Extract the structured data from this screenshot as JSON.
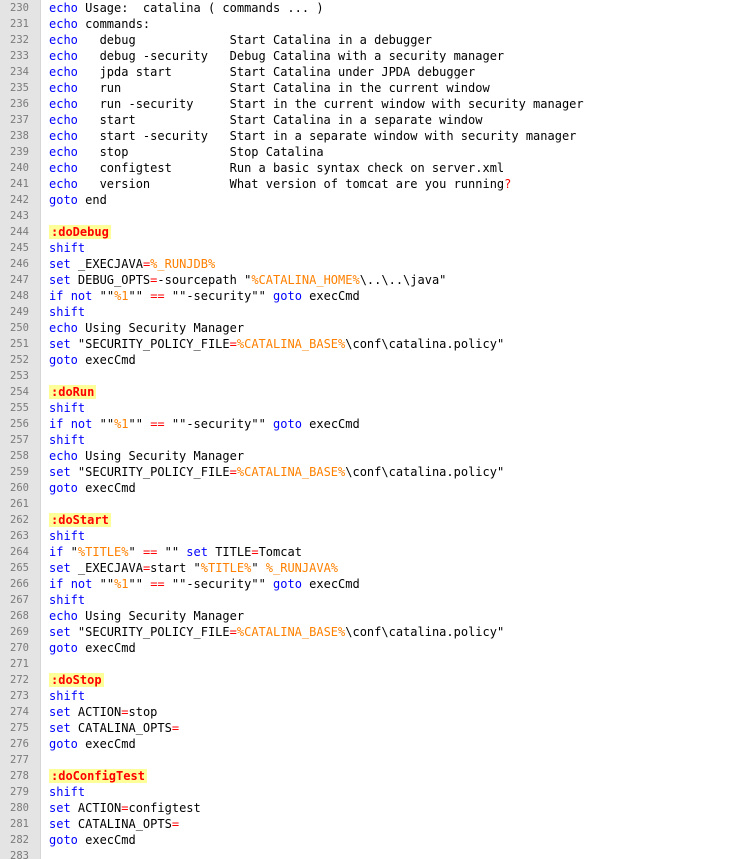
{
  "editor": {
    "colors": {
      "keyword": "#0000ff",
      "operator": "#ff0000",
      "variable": "#ff8000",
      "label": "#ff0000",
      "label_background": "#ffff99",
      "gutter_background": "#e4e4e4",
      "line_number": "#7a7a7a"
    },
    "lines": [
      {
        "num": "230",
        "tokens": [
          {
            "t": "echo",
            "c": "kw"
          },
          {
            "t": " Usage:  catalina ( commands ... )"
          }
        ]
      },
      {
        "num": "231",
        "tokens": [
          {
            "t": "echo",
            "c": "kw"
          },
          {
            "t": " commands:"
          }
        ]
      },
      {
        "num": "232",
        "tokens": [
          {
            "t": "echo",
            "c": "kw"
          },
          {
            "t": "   debug             Start Catalina in a debugger"
          }
        ]
      },
      {
        "num": "233",
        "tokens": [
          {
            "t": "echo",
            "c": "kw"
          },
          {
            "t": "   debug -security   Debug Catalina with a security manager"
          }
        ]
      },
      {
        "num": "234",
        "tokens": [
          {
            "t": "echo",
            "c": "kw"
          },
          {
            "t": "   jpda start        Start Catalina under JPDA debugger"
          }
        ]
      },
      {
        "num": "235",
        "tokens": [
          {
            "t": "echo",
            "c": "kw"
          },
          {
            "t": "   run               Start Catalina in the current window"
          }
        ]
      },
      {
        "num": "236",
        "tokens": [
          {
            "t": "echo",
            "c": "kw"
          },
          {
            "t": "   run -security     Start in the current window with security manager"
          }
        ]
      },
      {
        "num": "237",
        "tokens": [
          {
            "t": "echo",
            "c": "kw"
          },
          {
            "t": "   start             Start Catalina in a separate window"
          }
        ]
      },
      {
        "num": "238",
        "tokens": [
          {
            "t": "echo",
            "c": "kw"
          },
          {
            "t": "   start -security   Start in a separate window with security manager"
          }
        ]
      },
      {
        "num": "239",
        "tokens": [
          {
            "t": "echo",
            "c": "kw"
          },
          {
            "t": "   stop              Stop Catalina"
          }
        ]
      },
      {
        "num": "240",
        "tokens": [
          {
            "t": "echo",
            "c": "kw"
          },
          {
            "t": "   configtest        Run a basic syntax check on server.xml"
          }
        ]
      },
      {
        "num": "241",
        "tokens": [
          {
            "t": "echo",
            "c": "kw"
          },
          {
            "t": "   version           What version of tomcat are you running"
          },
          {
            "t": "?",
            "c": "op"
          }
        ]
      },
      {
        "num": "242",
        "tokens": [
          {
            "t": "goto",
            "c": "kw"
          },
          {
            "t": " end"
          }
        ]
      },
      {
        "num": "243",
        "tokens": []
      },
      {
        "num": "244",
        "tokens": [
          {
            "t": ":doDebug",
            "c": "lbl"
          }
        ]
      },
      {
        "num": "245",
        "tokens": [
          {
            "t": "shift",
            "c": "kw"
          }
        ]
      },
      {
        "num": "246",
        "tokens": [
          {
            "t": "set",
            "c": "kw"
          },
          {
            "t": " _EXECJAVA"
          },
          {
            "t": "=",
            "c": "op"
          },
          {
            "t": "%_RUNJDB%",
            "c": "var"
          }
        ]
      },
      {
        "num": "247",
        "tokens": [
          {
            "t": "set",
            "c": "kw"
          },
          {
            "t": " DEBUG_OPTS"
          },
          {
            "t": "=",
            "c": "op"
          },
          {
            "t": "-sourcepath \""
          },
          {
            "t": "%CATALINA_HOME%",
            "c": "var"
          },
          {
            "t": "\\..\\..\\java\""
          }
        ]
      },
      {
        "num": "248",
        "tokens": [
          {
            "t": "if",
            "c": "kw"
          },
          {
            "t": " "
          },
          {
            "t": "not",
            "c": "kw"
          },
          {
            "t": " \"\""
          },
          {
            "t": "%1",
            "c": "var"
          },
          {
            "t": "\"\" "
          },
          {
            "t": "==",
            "c": "op"
          },
          {
            "t": " \"\"-security\"\" "
          },
          {
            "t": "goto",
            "c": "kw"
          },
          {
            "t": " execCmd"
          }
        ]
      },
      {
        "num": "249",
        "tokens": [
          {
            "t": "shift",
            "c": "kw"
          }
        ]
      },
      {
        "num": "250",
        "tokens": [
          {
            "t": "echo",
            "c": "kw"
          },
          {
            "t": " Using Security Manager"
          }
        ]
      },
      {
        "num": "251",
        "tokens": [
          {
            "t": "set",
            "c": "kw"
          },
          {
            "t": " \"SECURITY_POLICY_FILE"
          },
          {
            "t": "=",
            "c": "op"
          },
          {
            "t": "%CATALINA_BASE%",
            "c": "var"
          },
          {
            "t": "\\conf\\catalina.policy\""
          }
        ]
      },
      {
        "num": "252",
        "tokens": [
          {
            "t": "goto",
            "c": "kw"
          },
          {
            "t": " execCmd"
          }
        ]
      },
      {
        "num": "253",
        "tokens": []
      },
      {
        "num": "254",
        "tokens": [
          {
            "t": ":doRun",
            "c": "lbl"
          }
        ]
      },
      {
        "num": "255",
        "tokens": [
          {
            "t": "shift",
            "c": "kw"
          }
        ]
      },
      {
        "num": "256",
        "tokens": [
          {
            "t": "if",
            "c": "kw"
          },
          {
            "t": " "
          },
          {
            "t": "not",
            "c": "kw"
          },
          {
            "t": " \"\""
          },
          {
            "t": "%1",
            "c": "var"
          },
          {
            "t": "\"\" "
          },
          {
            "t": "==",
            "c": "op"
          },
          {
            "t": " \"\"-security\"\" "
          },
          {
            "t": "goto",
            "c": "kw"
          },
          {
            "t": " execCmd"
          }
        ]
      },
      {
        "num": "257",
        "tokens": [
          {
            "t": "shift",
            "c": "kw"
          }
        ]
      },
      {
        "num": "258",
        "tokens": [
          {
            "t": "echo",
            "c": "kw"
          },
          {
            "t": " Using Security Manager"
          }
        ]
      },
      {
        "num": "259",
        "tokens": [
          {
            "t": "set",
            "c": "kw"
          },
          {
            "t": " \"SECURITY_POLICY_FILE"
          },
          {
            "t": "=",
            "c": "op"
          },
          {
            "t": "%CATALINA_BASE%",
            "c": "var"
          },
          {
            "t": "\\conf\\catalina.policy\""
          }
        ]
      },
      {
        "num": "260",
        "tokens": [
          {
            "t": "goto",
            "c": "kw"
          },
          {
            "t": " execCmd"
          }
        ]
      },
      {
        "num": "261",
        "tokens": []
      },
      {
        "num": "262",
        "tokens": [
          {
            "t": ":doStart",
            "c": "lbl"
          }
        ]
      },
      {
        "num": "263",
        "tokens": [
          {
            "t": "shift",
            "c": "kw"
          }
        ]
      },
      {
        "num": "264",
        "tokens": [
          {
            "t": "if",
            "c": "kw"
          },
          {
            "t": " \""
          },
          {
            "t": "%TITLE%",
            "c": "var"
          },
          {
            "t": "\" "
          },
          {
            "t": "==",
            "c": "op"
          },
          {
            "t": " \"\" "
          },
          {
            "t": "set",
            "c": "kw"
          },
          {
            "t": " TITLE"
          },
          {
            "t": "=",
            "c": "op"
          },
          {
            "t": "Tomcat"
          }
        ]
      },
      {
        "num": "265",
        "tokens": [
          {
            "t": "set",
            "c": "kw"
          },
          {
            "t": " _EXECJAVA"
          },
          {
            "t": "=",
            "c": "op"
          },
          {
            "t": "start \""
          },
          {
            "t": "%TITLE%",
            "c": "var"
          },
          {
            "t": "\" "
          },
          {
            "t": "%_RUNJAVA%",
            "c": "var"
          }
        ]
      },
      {
        "num": "266",
        "tokens": [
          {
            "t": "if",
            "c": "kw"
          },
          {
            "t": " "
          },
          {
            "t": "not",
            "c": "kw"
          },
          {
            "t": " \"\""
          },
          {
            "t": "%1",
            "c": "var"
          },
          {
            "t": "\"\" "
          },
          {
            "t": "==",
            "c": "op"
          },
          {
            "t": " \"\"-security\"\" "
          },
          {
            "t": "goto",
            "c": "kw"
          },
          {
            "t": " execCmd"
          }
        ]
      },
      {
        "num": "267",
        "tokens": [
          {
            "t": "shift",
            "c": "kw"
          }
        ]
      },
      {
        "num": "268",
        "tokens": [
          {
            "t": "echo",
            "c": "kw"
          },
          {
            "t": " Using Security Manager"
          }
        ]
      },
      {
        "num": "269",
        "tokens": [
          {
            "t": "set",
            "c": "kw"
          },
          {
            "t": " \"SECURITY_POLICY_FILE"
          },
          {
            "t": "=",
            "c": "op"
          },
          {
            "t": "%CATALINA_BASE%",
            "c": "var"
          },
          {
            "t": "\\conf\\catalina.policy\""
          }
        ]
      },
      {
        "num": "270",
        "tokens": [
          {
            "t": "goto",
            "c": "kw"
          },
          {
            "t": " execCmd"
          }
        ]
      },
      {
        "num": "271",
        "tokens": []
      },
      {
        "num": "272",
        "tokens": [
          {
            "t": ":doStop",
            "c": "lbl"
          }
        ]
      },
      {
        "num": "273",
        "tokens": [
          {
            "t": "shift",
            "c": "kw"
          }
        ]
      },
      {
        "num": "274",
        "tokens": [
          {
            "t": "set",
            "c": "kw"
          },
          {
            "t": " ACTION"
          },
          {
            "t": "=",
            "c": "op"
          },
          {
            "t": "stop"
          }
        ]
      },
      {
        "num": "275",
        "tokens": [
          {
            "t": "set",
            "c": "kw"
          },
          {
            "t": " CATALINA_OPTS"
          },
          {
            "t": "=",
            "c": "op"
          }
        ]
      },
      {
        "num": "276",
        "tokens": [
          {
            "t": "goto",
            "c": "kw"
          },
          {
            "t": " execCmd"
          }
        ]
      },
      {
        "num": "277",
        "tokens": []
      },
      {
        "num": "278",
        "tokens": [
          {
            "t": ":doConfigTest",
            "c": "lbl"
          }
        ]
      },
      {
        "num": "279",
        "tokens": [
          {
            "t": "shift",
            "c": "kw"
          }
        ]
      },
      {
        "num": "280",
        "tokens": [
          {
            "t": "set",
            "c": "kw"
          },
          {
            "t": " ACTION"
          },
          {
            "t": "=",
            "c": "op"
          },
          {
            "t": "configtest"
          }
        ]
      },
      {
        "num": "281",
        "tokens": [
          {
            "t": "set",
            "c": "kw"
          },
          {
            "t": " CATALINA_OPTS"
          },
          {
            "t": "=",
            "c": "op"
          }
        ]
      },
      {
        "num": "282",
        "tokens": [
          {
            "t": "goto",
            "c": "kw"
          },
          {
            "t": " execCmd"
          }
        ]
      },
      {
        "num": "283",
        "tokens": []
      }
    ]
  }
}
